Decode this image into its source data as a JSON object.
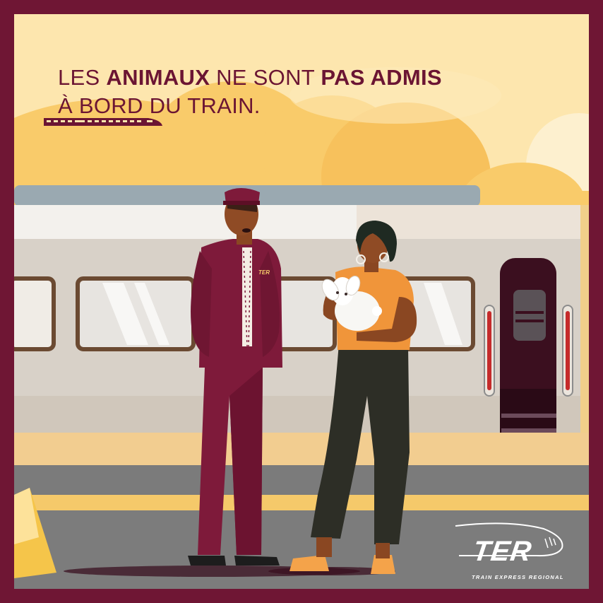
{
  "headline": {
    "line1_part1": "LES ",
    "line1_bold1": "ANIMAUX",
    "line1_part2": " NE SONT ",
    "line1_bold2": "PAS ADMIS",
    "line2": "À BORD DU TRAIN."
  },
  "logo": {
    "name": "TER",
    "tagline": "TRAIN EXPRESS REGIONAL"
  },
  "conductor": {
    "badge": "TER"
  },
  "colors": {
    "frame": "#6f1634",
    "sky": "#fde6ae",
    "clouds": "#f9c965",
    "train_body": "#d9d2c9",
    "window_frame": "#6b4a32",
    "door": "#3b0f1f",
    "platform": "#7b7b7b",
    "platform_stripe": "#f5c96a",
    "uniform": "#7e1a3a",
    "pants": "#2d2e26",
    "shirt": "#f0953a"
  },
  "icons": [
    "train-icon",
    "rabbit-icon",
    "cone-icon",
    "logo-swoosh-icon"
  ]
}
